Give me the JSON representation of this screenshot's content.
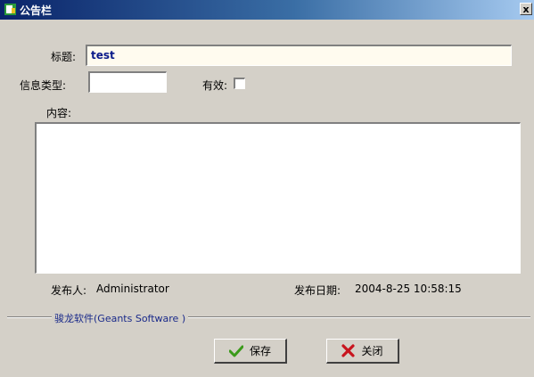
{
  "window": {
    "title": "公告栏",
    "close_label": "x"
  },
  "form": {
    "title_label": "标题",
    "title_value": "test",
    "info_type_label": "信息类型",
    "info_type_value": "",
    "valid_label": "有效",
    "valid_checked": false,
    "content_label": "内容",
    "content_value": ""
  },
  "meta": {
    "publisher_label": "发布人",
    "publisher_value": "Administrator",
    "date_label": "发布日期",
    "date_value": "2004-8-25 10:58:15"
  },
  "footer": {
    "brand": "骏龙软件(Geants Software )"
  },
  "buttons": {
    "save_label": "保存",
    "close_label": "关闭"
  },
  "colors": {
    "titlebar_start": "#0a246a",
    "save_check": "#3a9a1a",
    "close_x": "#c8141e",
    "brand_text": "#1a2a8a"
  }
}
